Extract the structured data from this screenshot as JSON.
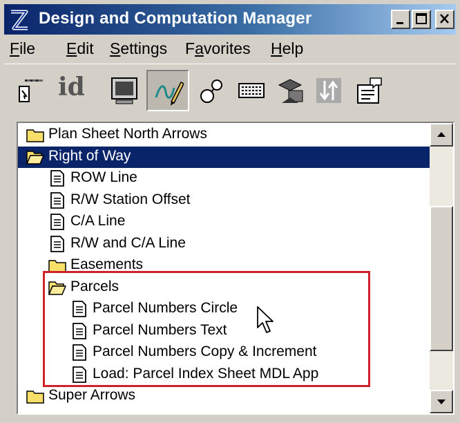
{
  "window": {
    "title": "Design and Computation Manager"
  },
  "menu": [
    {
      "label": "File",
      "mnemonic": "F",
      "rest": "ile"
    },
    {
      "label": "Edit",
      "mnemonic": "E",
      "rest": "dit"
    },
    {
      "label": "Settings",
      "mnemonic": "S",
      "rest": "ettings"
    },
    {
      "pre": "F",
      "mnemonic": "a",
      "rest": "vorites",
      "label": "Favorites"
    },
    {
      "label": "Help",
      "mnemonic": "H",
      "rest": "elp"
    }
  ],
  "toolbar": {
    "id_label": "id",
    "tools": [
      "key-icon",
      "id-icon",
      "monitor-icon",
      "design-pencil-icon",
      "cells-icon",
      "keyboard-icon",
      "database-icon",
      "sort-icon",
      "properties-icon"
    ]
  },
  "tree": [
    {
      "label": "Plan Sheet North Arrows",
      "type": "folder",
      "level": 0
    },
    {
      "label": "Right of Way",
      "type": "folder-open",
      "level": 0,
      "selected": true
    },
    {
      "label": "ROW Line",
      "type": "doc",
      "level": 1
    },
    {
      "label": "R/W Station Offset",
      "type": "doc",
      "level": 1
    },
    {
      "label": "C/A  Line",
      "type": "doc",
      "level": 1
    },
    {
      "label": "R/W and C/A Line",
      "type": "doc",
      "level": 1
    },
    {
      "label": "Easements",
      "type": "folder",
      "level": 1
    },
    {
      "label": "Parcels",
      "type": "folder-open",
      "level": 1
    },
    {
      "label": "Parcel Numbers Circle",
      "type": "doc",
      "level": 2
    },
    {
      "label": "Parcel Numbers Text",
      "type": "doc",
      "level": 2
    },
    {
      "label": "Parcel Numbers Copy & Increment",
      "type": "doc",
      "level": 2
    },
    {
      "label": "Load: Parcel Index Sheet MDL App",
      "type": "doc",
      "level": 2
    },
    {
      "label": "Super Arrows",
      "type": "folder",
      "level": 0
    }
  ],
  "colors": {
    "selection": "#0a246a",
    "highlight_box": "#d0202a",
    "folder": "#f7df6a"
  }
}
